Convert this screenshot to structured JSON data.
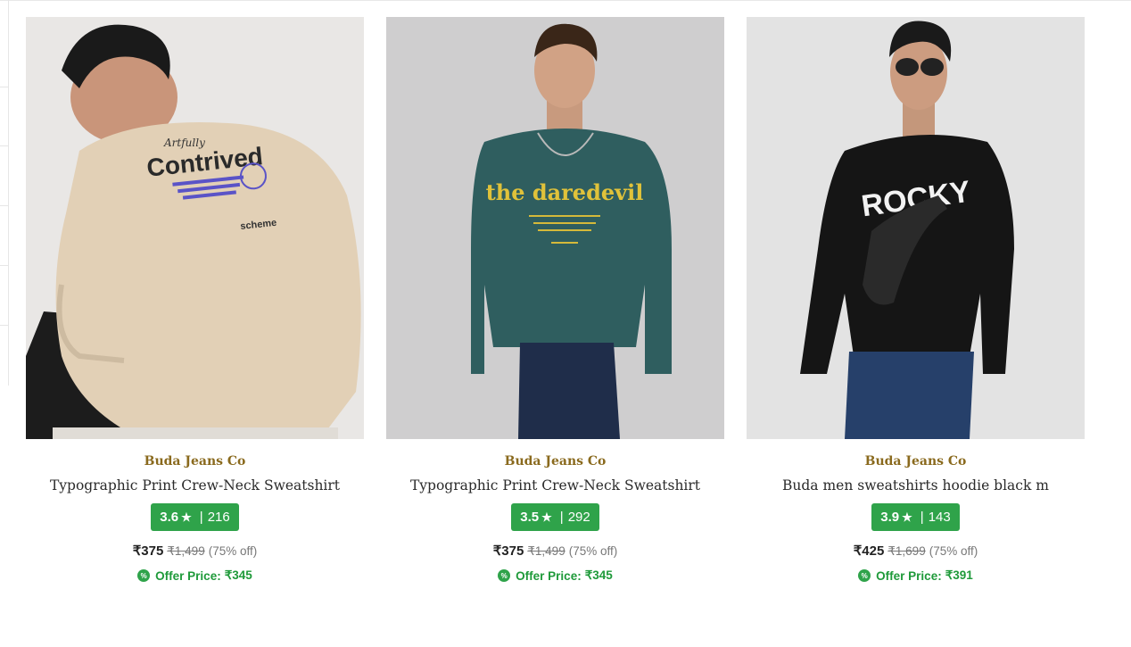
{
  "products": [
    {
      "brand": "Buda Jeans Co",
      "title": "Typographic Print Crew-Neck Sweatshirt",
      "rating": "3.6",
      "reviews": "216",
      "price": "₹375",
      "mrp": "₹1,499",
      "discount": "(75% off)",
      "offer_label": "Offer Price:",
      "offer_price": "₹345",
      "image": {
        "print_top": "Artfully",
        "print_main": "Contrived",
        "print_sub": "scheme",
        "shirt_color": "#e2d0b6"
      }
    },
    {
      "brand": "Buda Jeans Co",
      "title": "Typographic Print Crew-Neck Sweatshirt",
      "rating": "3.5",
      "reviews": "292",
      "price": "₹375",
      "mrp": "₹1,499",
      "discount": "(75% off)",
      "offer_label": "Offer Price:",
      "offer_price": "₹345",
      "image": {
        "print_main": "the daredevil",
        "shirt_color": "#2f5e5f"
      }
    },
    {
      "brand": "Buda Jeans Co",
      "title": "Buda men sweatshirts hoodie black m",
      "rating": "3.9",
      "reviews": "143",
      "price": "₹425",
      "mrp": "₹1,699",
      "discount": "(75% off)",
      "offer_label": "Offer Price:",
      "offer_price": "₹391",
      "image": {
        "print_main": "ROCKY",
        "shirt_color": "#151515"
      }
    }
  ],
  "colors": {
    "brand": "#8a6a1e",
    "rating_bg": "#2fa34a",
    "offer": "#1f9a3a"
  },
  "icons": {
    "rating": "star-icon",
    "offer": "percent-badge-icon"
  }
}
